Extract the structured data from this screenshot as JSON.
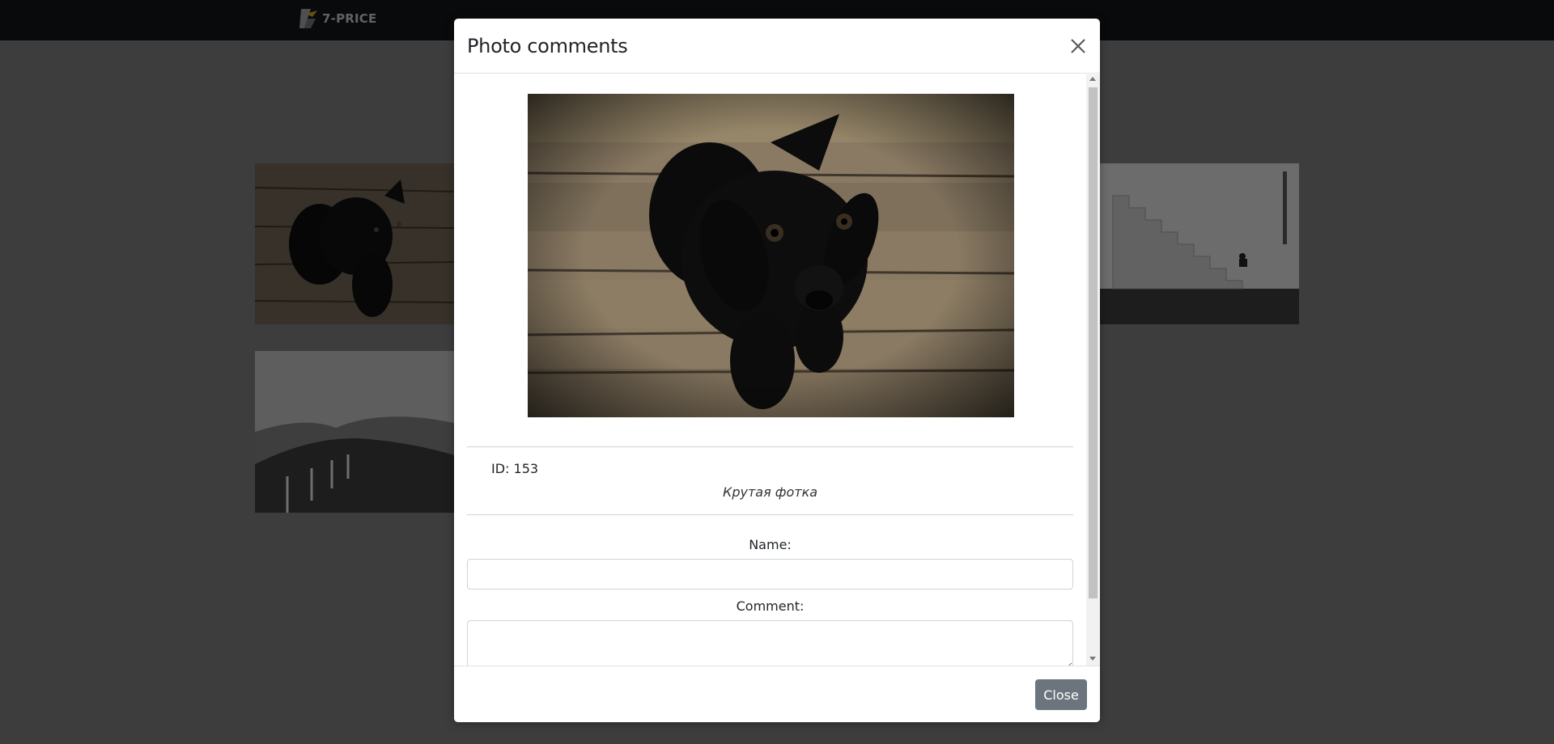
{
  "navbar": {
    "logo_text": "7-PRICE"
  },
  "gallery": {
    "thumbnails": [
      {
        "name": "puppy-thumbnail",
        "alt": "black puppy on wooden floor"
      },
      {
        "name": "stairs-thumbnail",
        "alt": "stone stairs by water"
      },
      {
        "name": "hills-thumbnail",
        "alt": "hills with fence path"
      }
    ]
  },
  "modal": {
    "title": "Photo comments",
    "photo_id_label": "ID: 153",
    "caption": "Крутая фотка",
    "name_label": "Name:",
    "name_value": "",
    "comment_label": "Comment:",
    "comment_value": "",
    "close_button_label": "Close"
  }
}
